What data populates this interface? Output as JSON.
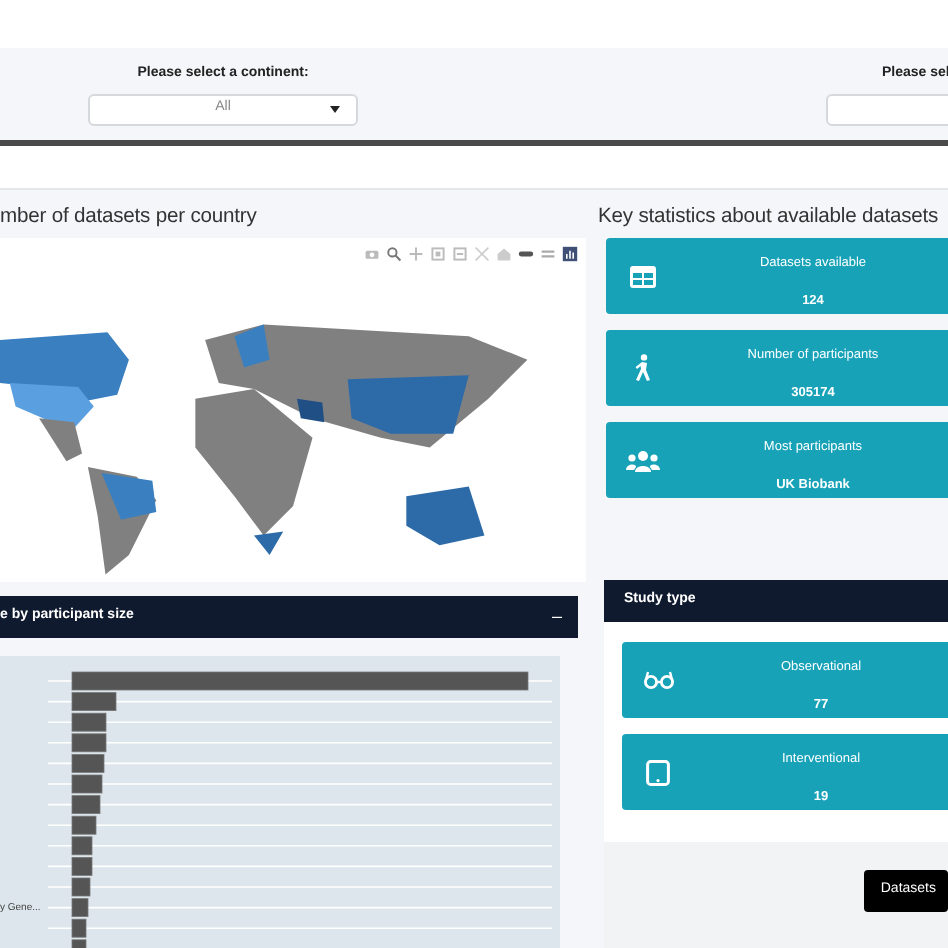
{
  "filters": [
    {
      "label": "Please select a continent:",
      "value": "All"
    },
    {
      "label": "Please sel"
    }
  ],
  "map_panel": {
    "title": "mber of datasets per country",
    "kind": "picture"
  },
  "key_statistics": {
    "title": "Key statistics about available datasets",
    "boxes": [
      {
        "kind": "table",
        "label": "Datasets available",
        "value": "124"
      },
      {
        "kind": "walker",
        "label": "Number of participants",
        "value": "305174"
      },
      {
        "kind": "users",
        "label": "Most participants",
        "value": "UK Biobank"
      }
    ]
  },
  "size_card": {
    "title": "e by participant size",
    "collapse": "–",
    "axis_label": "y Gene..."
  },
  "study_card": {
    "title": "Study type",
    "boxes": [
      {
        "kind": "glasses",
        "label": "Observational",
        "value": "77"
      },
      {
        "kind": "tablet",
        "label": "Interventional",
        "value": "19"
      }
    ],
    "button": "Datasets"
  }
}
